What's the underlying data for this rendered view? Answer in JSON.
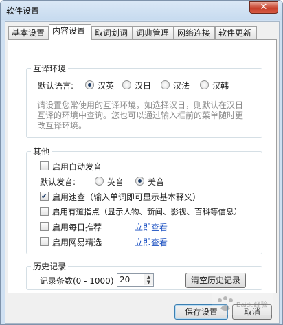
{
  "window": {
    "title": "软件设置",
    "close_icon": "close-icon"
  },
  "tabs": [
    {
      "label": "基本设置"
    },
    {
      "label": "内容设置"
    },
    {
      "label": "取词划词"
    },
    {
      "label": "词典管理"
    },
    {
      "label": "网络连接"
    },
    {
      "label": "软件更新"
    }
  ],
  "active_tab": "内容设置",
  "env": {
    "title": "互译环境",
    "label": "默认语言:",
    "options": [
      "汉英",
      "汉日",
      "汉法",
      "汉韩"
    ],
    "selected": "汉英",
    "hint": "请设置您常使用的互译环境，如选择汉日，则默认在汉日互译的环境中查询。您也可以通过输入框前的菜单随时更改互译环境。"
  },
  "other": {
    "title": "其他",
    "auto_pronounce": {
      "label": "启用自动发音",
      "checked": false
    },
    "pron_label": "默认发音:",
    "pron_options": [
      "英音",
      "美音"
    ],
    "pron_selected": "美音",
    "quick_lookup": {
      "label": "启用速查（输入单词即可显示基本释义）",
      "checked": true
    },
    "youdao_tips": {
      "label": "启用有道指点（显示人物、新闻、影视、百科等信息）",
      "checked": false
    },
    "daily": {
      "label": "启用每日推荐",
      "checked": false,
      "link": "立即查看"
    },
    "netease": {
      "label": "启用网易精选",
      "checked": false,
      "link": "立即查看"
    }
  },
  "history": {
    "title": "历史记录",
    "count_label": "记录条数(0 - 1000)",
    "count_value": "20",
    "clear_button": "清空历史记录"
  },
  "footer": {
    "save": "保存设置",
    "cancel": "取消"
  },
  "watermark": "Baidu经验"
}
